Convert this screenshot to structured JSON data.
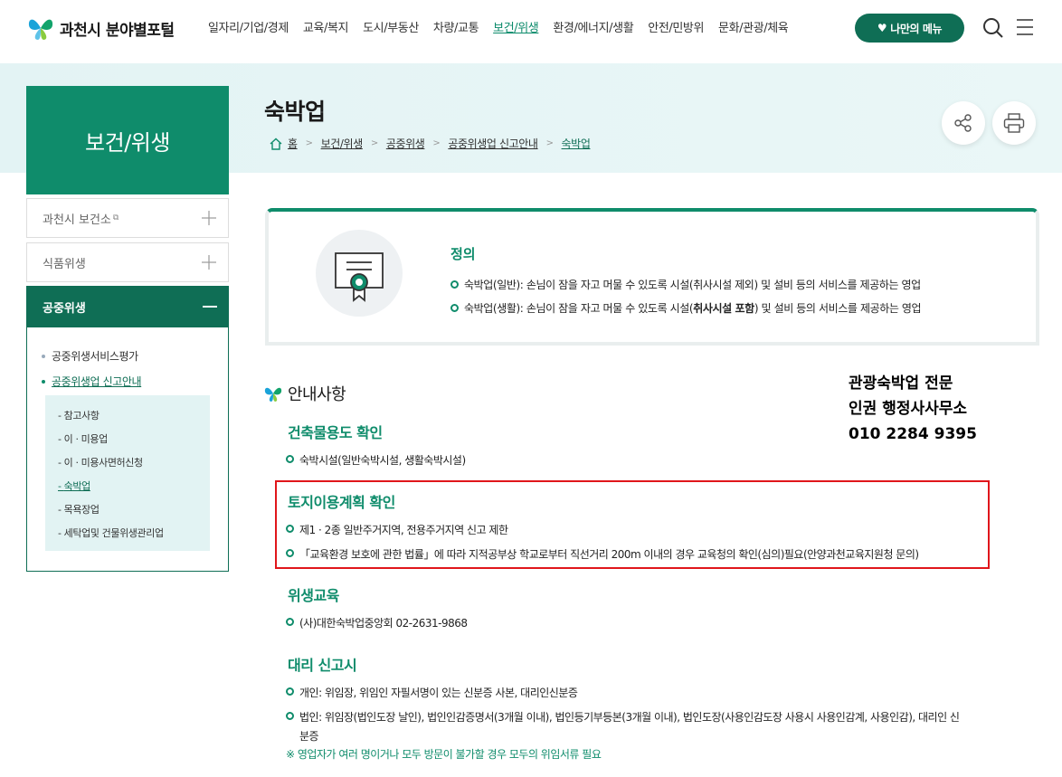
{
  "header": {
    "logo_city": "과천시",
    "logo_portal": "분야별포털",
    "nav": [
      "일자리/기업/경제",
      "교육/복지",
      "도시/부동산",
      "차량/교통",
      "보건/위생",
      "환경/에너지/생활",
      "안전/민방위",
      "문화/관광/체육"
    ],
    "nav_active_index": 4,
    "my_menu": "나만의 메뉴"
  },
  "sidebar": {
    "title": "보건/위생",
    "items": [
      {
        "label": "과천시 보건소"
      },
      {
        "label": "식품위생"
      }
    ],
    "active": {
      "label": "공중위생",
      "children": [
        {
          "label": "공중위생서비스평가"
        },
        {
          "label": "공중위생업 신고안내",
          "active": true
        }
      ],
      "subchildren": [
        "참고사항",
        "이 · 미용업",
        "이 · 미용사면허신청",
        "숙박업",
        "목욕장업",
        "세탁업및 건물위생관리업"
      ],
      "subchildren_active_index": 3
    }
  },
  "page": {
    "title": "숙박업",
    "breadcrumb": [
      "홈",
      "보건/위생",
      "공중위생",
      "공중위생업 신고안내",
      "숙박업"
    ]
  },
  "definition": {
    "title": "정의",
    "lines": [
      {
        "pre": "숙박업(일반): 손님이 잠을 자고 머물 수 있도록 시설(취사시설 제외) 및 설비 등의 서비스를 제공하는 영업",
        "bold": "",
        "post": ""
      },
      {
        "pre": "숙박업(생활): 손님이 잠을 자고 머물 수 있도록 시설(",
        "bold": "취사시설 포함",
        "post": ") 및 설비 등의 서비스를 제공하는 영업"
      }
    ]
  },
  "guide": {
    "heading": "안내사항",
    "sections": [
      {
        "title": "건축물용도 확인",
        "lines": [
          "숙박시설(일반숙박시설, 생활숙박시설)"
        ]
      },
      {
        "title": "토지이용계획 확인",
        "lines": [
          "제1 · 2종 일반주거지역, 전용주거지역 신고 제한",
          "「교육환경 보호에 관한 법률」에 따라 지적공부상 학교로부터 직선거리 200m 이내의 경우 교육청의 확인(심의)필요(안양과천교육지원청 문의)"
        ]
      },
      {
        "title": "위생교육",
        "lines": [
          "(사)대한숙박업중앙회 02-2631-9868"
        ]
      },
      {
        "title": "대리 신고시",
        "lines": [
          "개인: 위임장, 위임인 자필서명이 있는 신분증 사본, 대리인신분증",
          "법인: 위임장(법인도장 날인), 법인인감증명서(3개월 이내), 법인등기부등본(3개월 이내), 법인도장(사용인감도장 사용시 사용인감계, 사용인감), 대리인 신",
          "분증"
        ]
      }
    ],
    "note": "※ 영업자가 여러 명이거나 모두 방문이 불가할 경우 모두의 위임서류 필요"
  },
  "overlay": {
    "line1": "관광숙박업 전문",
    "line2": "인권 행정사사무소",
    "line3": "010 2284 9395"
  },
  "colors": {
    "primary": "#0f8c6b",
    "dark": "#0f6e55",
    "highlight": "#e0161b"
  }
}
